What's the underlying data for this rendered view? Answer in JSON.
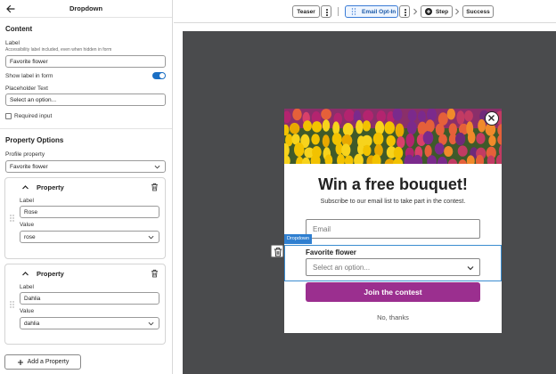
{
  "panel": {
    "title": "Dropdown",
    "content_heading": "Content",
    "label_label": "Label",
    "label_help": "Accessibility label included, even when hidden in form",
    "label_value": "Favorite flower",
    "show_label_text": "Show label in form",
    "placeholder_label": "Placeholder Text",
    "placeholder_value": "Select an option...",
    "required_label": "Required input",
    "property_options_heading": "Property Options",
    "profile_property_label": "Profile property",
    "profile_property_value": "Favorite flower",
    "properties": [
      {
        "title": "Property",
        "label_label": "Label",
        "label_value": "Rose",
        "value_label": "Value",
        "value_value": "rose"
      },
      {
        "title": "Property",
        "label_label": "Label",
        "label_value": "Dahlia",
        "value_label": "Value",
        "value_value": "dahlia"
      }
    ],
    "add_property_label": "Add a Property"
  },
  "steps": {
    "teaser": "Teaser",
    "email_opt_in": "Email Opt-In",
    "step": "Step",
    "success": "Success"
  },
  "modal": {
    "title": "Win a free bouquet!",
    "subtitle": "Subscribe to our email list to take part in the contest.",
    "email_placeholder": "Email",
    "selected_tag": "Dropdown",
    "field_label": "Favorite flower",
    "select_placeholder": "Select an option...",
    "submit_label": "Join the contest",
    "decline_label": "No, thanks"
  },
  "colors": {
    "accent": "#1b6fc4",
    "submit": "#9b2f8f",
    "canvas": "#4a4b4d"
  }
}
